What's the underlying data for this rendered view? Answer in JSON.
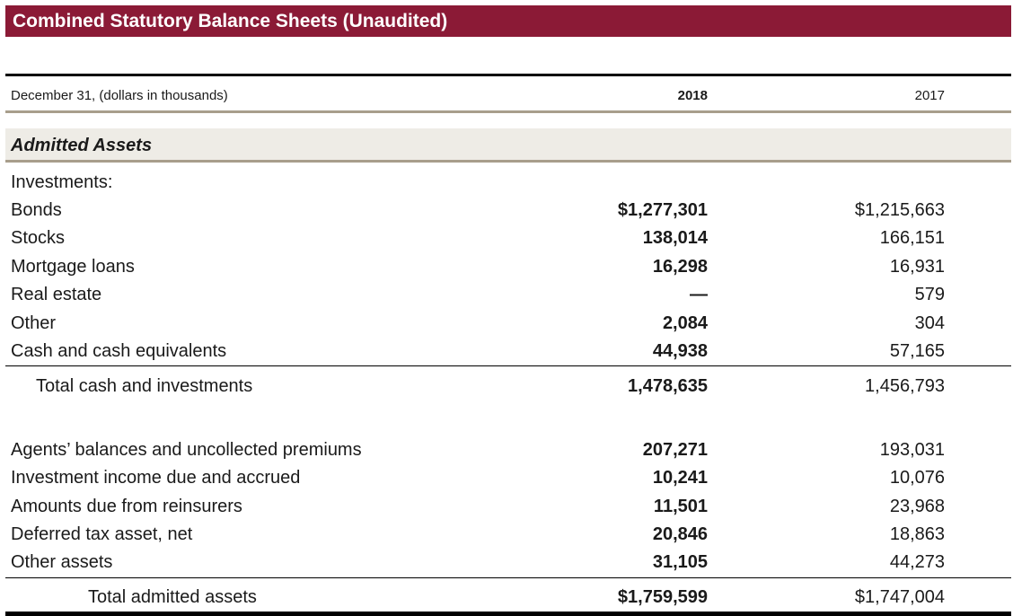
{
  "title": "Combined Statutory Balance Sheets (Unaudited)",
  "header": {
    "label": "December 31, (dollars in thousands)",
    "year_current": "2018",
    "year_prior": "2017"
  },
  "section": "Admitted Assets",
  "rows": [
    {
      "label": "Investments:",
      "v2018": "",
      "v2017": ""
    },
    {
      "label": "Bonds",
      "v2018": "$1,277,301",
      "v2017": "$1,215,663"
    },
    {
      "label": "Stocks",
      "v2018": "138,014",
      "v2017": "166,151"
    },
    {
      "label": "Mortgage loans",
      "v2018": "16,298",
      "v2017": "16,931"
    },
    {
      "label": "Real estate",
      "v2018": "—",
      "v2017": "579"
    },
    {
      "label": "Other",
      "v2018": "2,084",
      "v2017": "304"
    },
    {
      "label": "Cash and cash equivalents",
      "v2018": "44,938",
      "v2017": "57,165"
    },
    {
      "label": "Total cash and investments",
      "v2018": "1,478,635",
      "v2017": "1,456,793"
    },
    {
      "label": "Agents’ balances and uncollected premiums",
      "v2018": "207,271",
      "v2017": "193,031"
    },
    {
      "label": "Investment income due and accrued",
      "v2018": "10,241",
      "v2017": "10,076"
    },
    {
      "label": "Amounts due from reinsurers",
      "v2018": "11,501",
      "v2017": "23,968"
    },
    {
      "label": "Deferred tax asset, net",
      "v2018": "20,846",
      "v2017": "18,863"
    },
    {
      "label": "Other assets",
      "v2018": "31,105",
      "v2017": "44,273"
    },
    {
      "label": "Total admitted assets",
      "v2018": "$1,759,599",
      "v2017": "$1,747,004"
    }
  ]
}
